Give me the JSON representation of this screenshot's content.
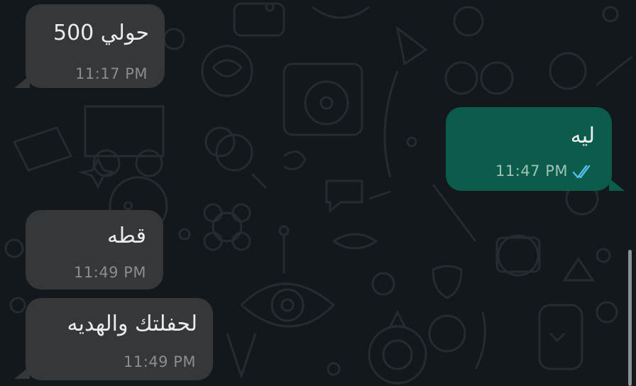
{
  "messages": [
    {
      "direction": "incoming",
      "text": "حولي 500",
      "time": "11:17 PM"
    },
    {
      "direction": "outgoing",
      "text": "ليه",
      "time": "11:47 PM",
      "status_icon": "double-check-read-icon"
    },
    {
      "direction": "incoming",
      "text": "قطه",
      "time": "11:49 PM"
    },
    {
      "direction": "incoming",
      "text": "لحفلتك والهديه",
      "time": "11:49 PM"
    }
  ],
  "colors": {
    "background": "#12181c",
    "incoming_bubble": "#353739",
    "outgoing_bubble": "#0c5c4b",
    "read_ticks": "#53bdeb",
    "timestamp": "#8a8e91"
  }
}
